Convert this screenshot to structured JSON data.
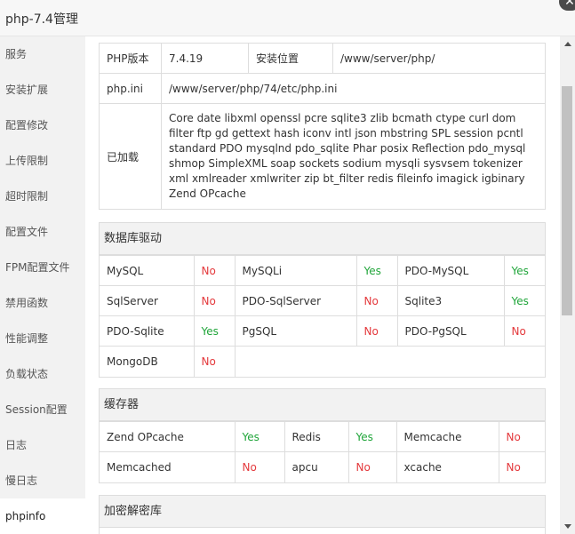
{
  "window": {
    "title": "php-7.4管理",
    "close_glyph": "✕"
  },
  "sidebar": {
    "items": [
      {
        "label": "服务"
      },
      {
        "label": "安装扩展"
      },
      {
        "label": "配置修改"
      },
      {
        "label": "上传限制"
      },
      {
        "label": "超时限制"
      },
      {
        "label": "配置文件"
      },
      {
        "label": "FPM配置文件"
      },
      {
        "label": "禁用函数"
      },
      {
        "label": "性能调整"
      },
      {
        "label": "负载状态"
      },
      {
        "label": "Session配置"
      },
      {
        "label": "日志"
      },
      {
        "label": "慢日志"
      },
      {
        "label": "phpinfo"
      }
    ],
    "active": "phpinfo"
  },
  "info": {
    "version_label": "PHP版本",
    "version_value": "7.4.19",
    "location_label": "安装位置",
    "location_value": "/www/server/php/",
    "ini_label": "php.ini",
    "ini_value": "/www/server/php/74/etc/php.ini",
    "loaded_label": "已加载",
    "loaded_value": "Core date libxml openssl pcre sqlite3 zlib bcmath ctype curl dom filter ftp gd gettext hash iconv intl json mbstring SPL session pcntl standard PDO mysqlnd pdo_sqlite Phar posix Reflection pdo_mysql shmop SimpleXML soap sockets sodium mysqli sysvsem tokenizer xml xmlreader xmlwriter zip bt_filter redis fileinfo imagick igbinary Zend OPcache"
  },
  "db": {
    "title": "数据库驱动",
    "rows": [
      [
        {
          "name": "MySQL",
          "status": "No"
        },
        {
          "name": "MySQLi",
          "status": "Yes"
        },
        {
          "name": "PDO-MySQL",
          "status": "Yes"
        }
      ],
      [
        {
          "name": "SqlServer",
          "status": "No"
        },
        {
          "name": "PDO-SqlServer",
          "status": "No"
        },
        {
          "name": "Sqlite3",
          "status": "Yes"
        }
      ],
      [
        {
          "name": "PDO-Sqlite",
          "status": "Yes"
        },
        {
          "name": "PgSQL",
          "status": "No"
        },
        {
          "name": "PDO-PgSQL",
          "status": "No"
        }
      ],
      [
        {
          "name": "MongoDB",
          "status": "No"
        }
      ]
    ]
  },
  "cache": {
    "title": "缓存器",
    "rows": [
      [
        {
          "name": "Zend OPcache",
          "status": "Yes"
        },
        {
          "name": "Redis",
          "status": "Yes"
        },
        {
          "name": "Memcache",
          "status": "No"
        }
      ],
      [
        {
          "name": "Memcached",
          "status": "No"
        },
        {
          "name": "apcu",
          "status": "No"
        },
        {
          "name": "xcache",
          "status": "No"
        }
      ]
    ]
  },
  "crypto": {
    "title": "加密解密库"
  },
  "colors": {
    "yes": "#20a53a",
    "no": "#e4393c",
    "header_bg": "#f2f2f2",
    "sidebar_bg": "#f2f2f2"
  }
}
